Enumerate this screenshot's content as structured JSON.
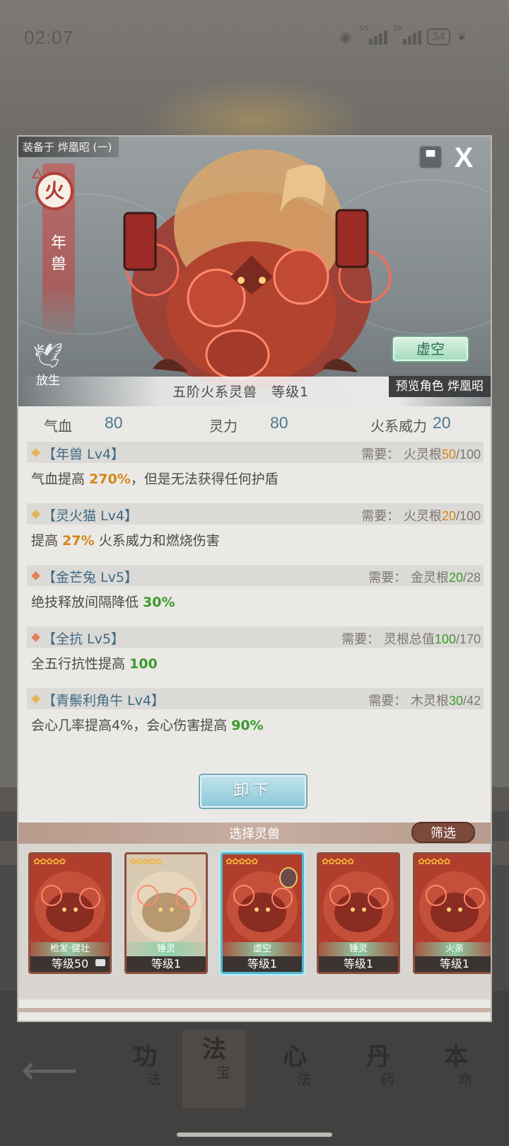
{
  "status_bar": {
    "time": "02:07",
    "net1": "5A",
    "net2": "5A",
    "battery": "34"
  },
  "modal": {
    "equipped_on": "装备于 烨凰昭 (一)",
    "element": "火",
    "beast_name_vertical": "年兽",
    "release_label": "放生",
    "void_button": "虚空",
    "info_line": "五阶火系灵兽　等级1",
    "preview_label": "预览角色 烨凰昭",
    "stats": [
      {
        "label": "气血",
        "value": "80"
      },
      {
        "label": "灵力",
        "value": "80"
      },
      {
        "label": "火系威力",
        "value": "20"
      }
    ],
    "skills": [
      {
        "name": "【年兽 Lv4】",
        "req_label": "需要：",
        "req_attr": "火灵根",
        "req_cur": "50",
        "req_max": "/100",
        "req_color": "orange",
        "diamond_color": "#e2b45a",
        "desc_pre": "气血提高 ",
        "desc_hl": "270%",
        "desc_post": "，但是无法获得任何护盾",
        "hl_color": "orange"
      },
      {
        "name": "【灵火猫 Lv4】",
        "req_label": "需要：",
        "req_attr": "火灵根",
        "req_cur": "20",
        "req_max": "/100",
        "req_color": "orange",
        "diamond_color": "#e2b45a",
        "desc_pre": "提高 ",
        "desc_hl": "27%",
        "desc_post": " 火系威力和燃烧伤害",
        "hl_color": "orange"
      },
      {
        "name": "【金芒兔 Lv5】",
        "req_label": "需要：",
        "req_attr": "金灵根",
        "req_cur": "20",
        "req_max": "/28",
        "req_color": "green",
        "diamond_color": "#e0825a",
        "desc_pre": "绝技释放间隔降低 ",
        "desc_hl": "30%",
        "desc_post": "",
        "hl_color": "green"
      },
      {
        "name": "【全抗 Lv5】",
        "req_label": "需要：",
        "req_attr": "灵根总值",
        "req_cur": "100",
        "req_max": "/170",
        "req_color": "green",
        "diamond_color": "#e0825a",
        "desc_pre": "全五行抗性提高 ",
        "desc_hl": "100",
        "desc_post": "",
        "hl_color": "green"
      },
      {
        "name": "【青鬃利角牛 Lv4】",
        "req_label": "需要：",
        "req_attr": "木灵根",
        "req_cur": "30",
        "req_max": "/42",
        "req_color": "green",
        "diamond_color": "#e2b45a",
        "desc_pre": "会心几率提高4%，会心伤害提高 ",
        "desc_hl": "90%",
        "desc_post": "",
        "hl_color": "green"
      }
    ],
    "unload_button": "卸下",
    "select_title": "选择灵兽",
    "filter_button": "筛选",
    "cards": [
      {
        "tag": "枪发·健壮",
        "level": "等级50",
        "style": "red",
        "selected": false
      },
      {
        "tag": "锤灵",
        "level": "等级1",
        "style": "pale",
        "selected": false
      },
      {
        "tag": "虚空",
        "level": "等级1",
        "style": "red",
        "selected": true
      },
      {
        "tag": "锤灵",
        "level": "等级1",
        "style": "red",
        "selected": false
      },
      {
        "tag": "火亲",
        "level": "等级1",
        "style": "red",
        "selected": false
      }
    ]
  },
  "bottom_nav": [
    {
      "big": "功",
      "small": "法"
    },
    {
      "big": "法",
      "small": "宝"
    },
    {
      "big": "心",
      "small": "法"
    },
    {
      "big": "丹",
      "small": "药"
    },
    {
      "big": "本",
      "small": "命"
    }
  ],
  "colors": {
    "orange": "#d4861a",
    "green": "#3a9b2f",
    "skill_name": "#3e6a86"
  }
}
